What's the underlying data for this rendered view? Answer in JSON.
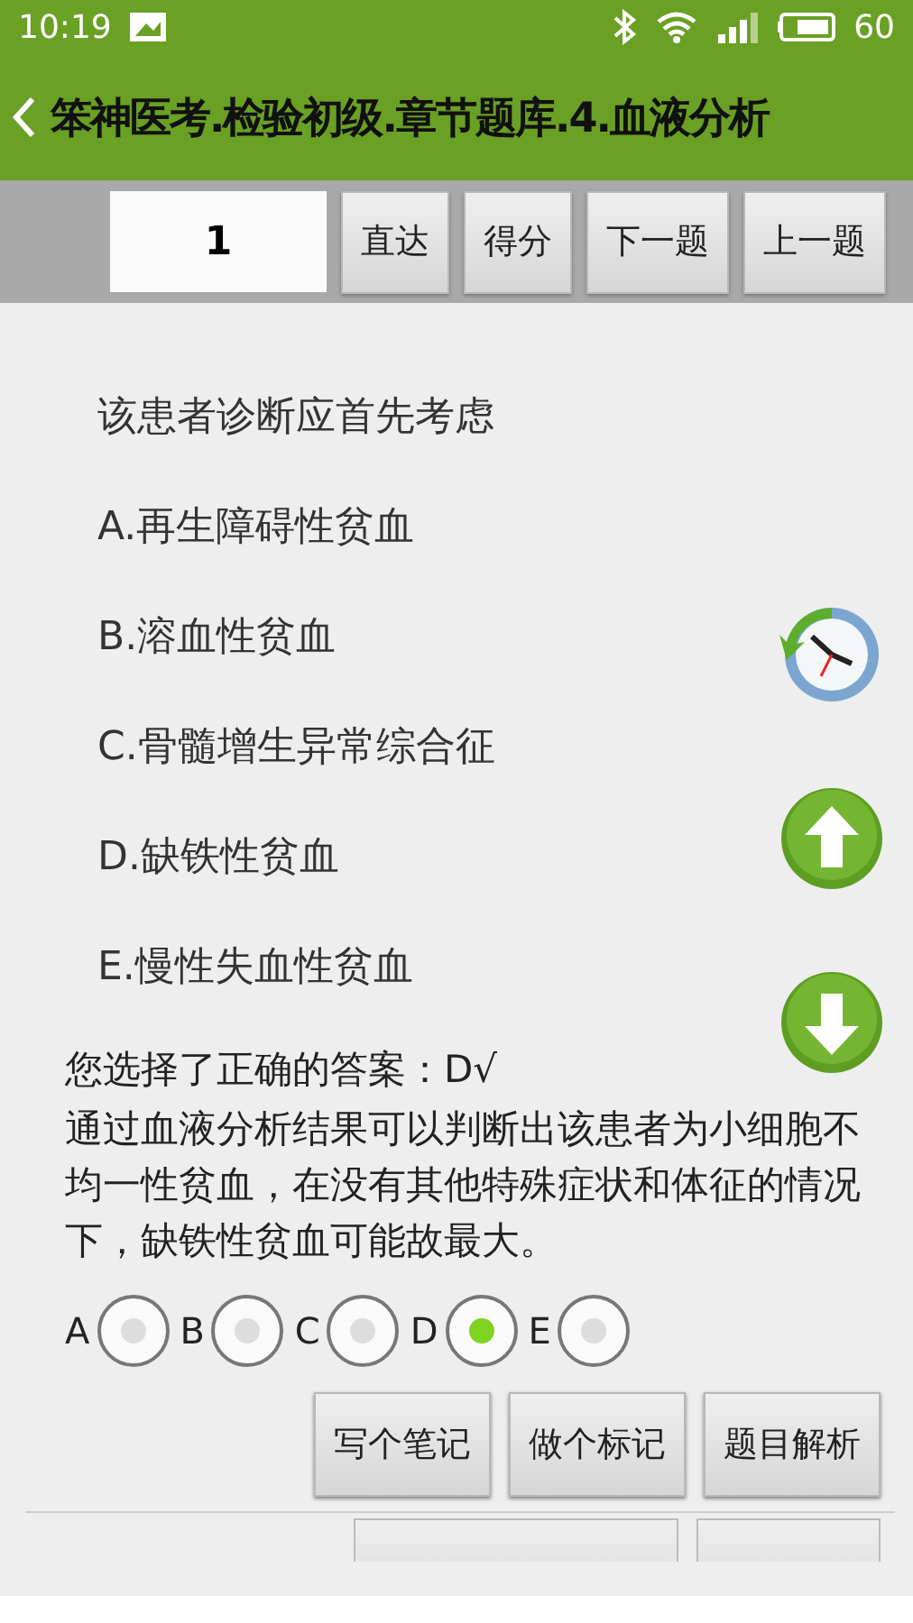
{
  "status_bar": {
    "time": "10:19",
    "battery": "60"
  },
  "title": "笨神医考.检验初级.章节题库.4.血液分析",
  "toolbar": {
    "question_number": "1",
    "buttons": [
      "直达",
      "得分",
      "下一题",
      "上一题"
    ]
  },
  "question": {
    "stem": "该患者诊断应首先考虑",
    "options": [
      "A.再生障碍性贫血",
      "B.溶血性贫血",
      "C.骨髓增生异常综合征",
      "D.缺铁性贫血",
      "E.慢性失血性贫血"
    ]
  },
  "result": "您选择了正确的答案：D√",
  "explanation": "通过血液分析结果可以判断出该患者为小细胞不均一性贫血，在没有其他特殊症状和体征的情况下，缺铁性贫血可能故最大。",
  "choices": [
    {
      "letter": "A",
      "selected": false
    },
    {
      "letter": "B",
      "selected": false
    },
    {
      "letter": "C",
      "selected": false
    },
    {
      "letter": "D",
      "selected": true
    },
    {
      "letter": "E",
      "selected": false
    }
  ],
  "action_buttons": [
    "写个笔记",
    "做个标记",
    "题目解析"
  ]
}
